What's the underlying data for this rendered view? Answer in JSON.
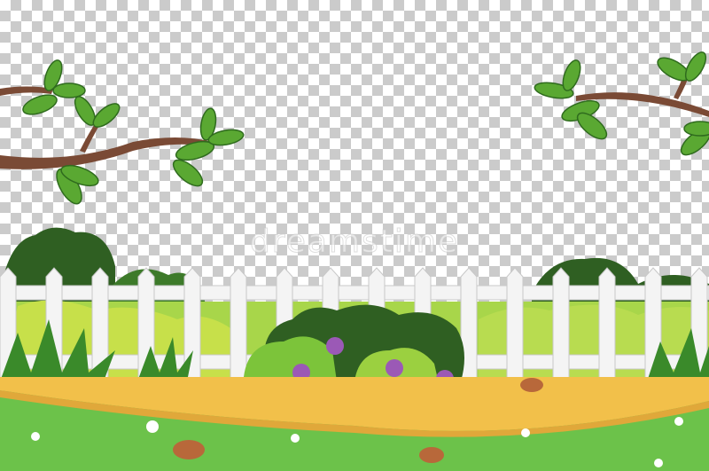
{
  "watermark": "dreamstime",
  "colors": {
    "grass": "#6cc24a",
    "path": "#f2c04a",
    "fence": "#f2f2f2",
    "branch": "#7a4a35",
    "leaf": "#5aa832",
    "bush_dark": "#2f5f22",
    "flower": "#9b59b6"
  }
}
